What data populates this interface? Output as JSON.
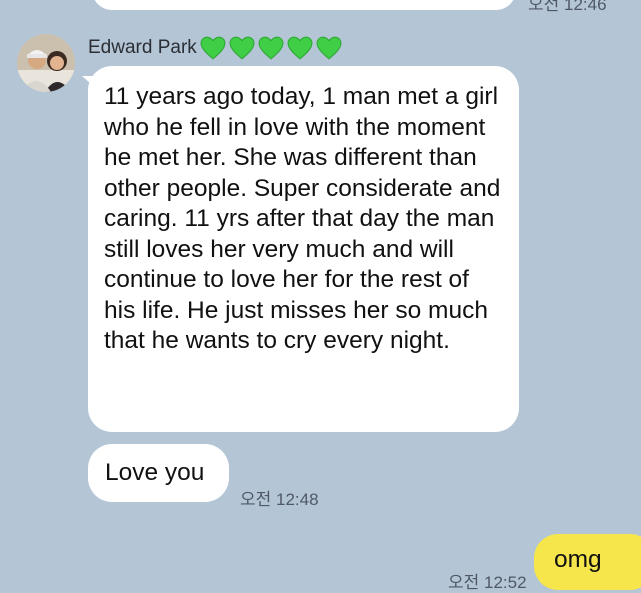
{
  "chat": {
    "previous_time": "오전 12:46",
    "sender": {
      "name": "Edward Park",
      "emoji": [
        "green-heart",
        "green-heart",
        "green-heart",
        "green-heart",
        "green-heart"
      ]
    },
    "messages": [
      {
        "from": "Edward Park",
        "text": "11 years ago today, 1 man met a girl who he fell in love with the moment he met her. She was different than other people. Super considerate and caring. 11 yrs after that day the man still loves her very much and will continue to love her for the rest of his life. He just misses her so much that he wants to cry every night."
      },
      {
        "from": "Edward Park",
        "text": "Love you",
        "time": "오전 12:48"
      }
    ],
    "reply": {
      "text": "omg",
      "time": "오전 12:52"
    }
  },
  "colors": {
    "background": "#b4c5d6",
    "incoming_bubble": "#ffffff",
    "outgoing_bubble": "#f6e64b",
    "heart": "#3fce45"
  }
}
